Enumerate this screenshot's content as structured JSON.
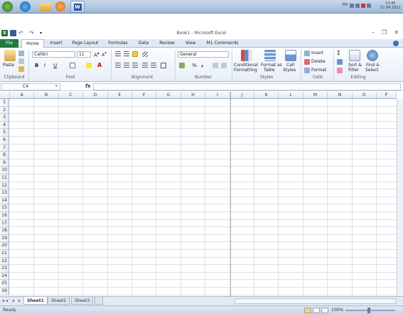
{
  "colors": {
    "file_tab": "#1f7a3f",
    "excel_green": "#1e7145",
    "ribbon_bg": "#e6eef8"
  },
  "taskbar": {
    "items": [
      "start-icon",
      "ie-icon",
      "folder-icon",
      "media-player-icon",
      "word-icon"
    ],
    "language": "EN",
    "clock_time": "13:45",
    "clock_date": "17.04.2011"
  },
  "window": {
    "title": "Book1 - Microsoft Excel"
  },
  "ribbon_tabs": [
    "File",
    "Home",
    "Insert",
    "Page Layout",
    "Formulas",
    "Data",
    "Review",
    "View",
    "M1 Commands"
  ],
  "ribbon": {
    "clipboard": {
      "paste": "Paste",
      "label": "Clipboard"
    },
    "font": {
      "name": "Calibri",
      "size": "11",
      "label": "Font",
      "bold": "B",
      "italic": "I",
      "underline": "U"
    },
    "alignment": {
      "label": "Alignment"
    },
    "number": {
      "format": "General",
      "label": "Number",
      "percent": "%",
      "comma": ","
    },
    "styles": {
      "conditional": "Conditional",
      "conditional2": "Formatting",
      "format_as": "Format as",
      "table": "Table",
      "cell": "Cell",
      "cell_styles": "Styles",
      "label": "Styles"
    },
    "cells": {
      "insert": "Insert",
      "delete": "Delete",
      "format": "Format",
      "label": "Cells"
    },
    "editing": {
      "sigma": "Σ",
      "sort": "Sort &",
      "filter": "Filter",
      "find": "Find &",
      "select": "Select",
      "label": "Editing"
    }
  },
  "formula_bar": {
    "name_box": "C4",
    "fx": "fx",
    "value": ""
  },
  "columns": [
    "A",
    "B",
    "C",
    "D",
    "E",
    "F",
    "G",
    "H",
    "I",
    "J",
    "K",
    "L",
    "M",
    "N",
    "O",
    "P"
  ],
  "rows": [
    "1",
    "2",
    "3",
    "4",
    "5",
    "6",
    "7",
    "8",
    "9",
    "10",
    "11",
    "12",
    "13",
    "14",
    "15",
    "16",
    "17",
    "18",
    "19",
    "20",
    "21",
    "22",
    "23",
    "24",
    "25",
    "26"
  ],
  "sheets": [
    "Sheet1",
    "Sheet2",
    "Sheet3"
  ],
  "active_sheet": "Sheet1",
  "status": {
    "text": "Ready",
    "zoom": "100%"
  }
}
